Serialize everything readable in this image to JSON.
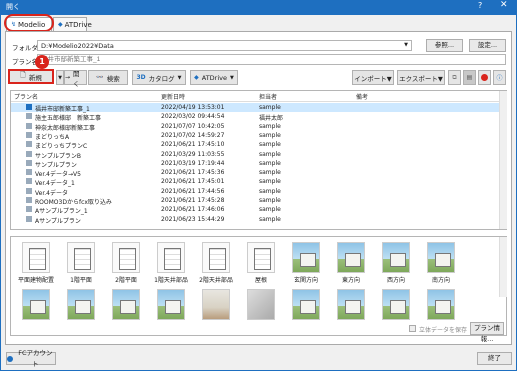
{
  "window": {
    "title": "開く",
    "help": "?",
    "close": "✕"
  },
  "tabs": [
    {
      "label": "Modelio"
    },
    {
      "label": "ATDrive"
    }
  ],
  "folder": {
    "label": "フォルダ",
    "value": "D:¥Modelio2022¥Data",
    "browse": "参照...",
    "settings": "設定..."
  },
  "plan_name": {
    "label": "プラン名",
    "placeholder": "福井市邸新築工事_1"
  },
  "toolbar": {
    "new_label": "新規",
    "callout": "1",
    "open_label": "開く",
    "search_label": "検索",
    "catalog_label": "カタログ",
    "atdrive_label": "ATDrive",
    "import_label": "インポート▼",
    "export_label": "エクスポート▼"
  },
  "list": {
    "columns": [
      "プラン名",
      "更新日時",
      "担当者",
      "備考"
    ],
    "rows": [
      {
        "name": "福井市邸新築工事_1",
        "date": "2022/04/19 13:53:01",
        "owner": "sample",
        "note": "",
        "selected": true
      },
      {
        "name": "施主五郎様邸　新築工事",
        "date": "2022/03/02 09:44:54",
        "owner": "福井太郎",
        "note": ""
      },
      {
        "name": "神奈太郎様邸新築工事",
        "date": "2021/07/07 10:42:05",
        "owner": "sample",
        "note": ""
      },
      {
        "name": "まどりっちA",
        "date": "2021/07/02 14:59:27",
        "owner": "sample",
        "note": ""
      },
      {
        "name": "まどりっちプランC",
        "date": "2021/06/21 17:45:10",
        "owner": "sample",
        "note": ""
      },
      {
        "name": "サンプルプランB",
        "date": "2021/03/29 11:03:55",
        "owner": "sample",
        "note": ""
      },
      {
        "name": "サンプルプラン",
        "date": "2021/03/19 17:19:44",
        "owner": "sample",
        "note": ""
      },
      {
        "name": "Ver.4データ→V5",
        "date": "2021/06/21 17:45:36",
        "owner": "sample",
        "note": ""
      },
      {
        "name": "Ver.4データ_1",
        "date": "2021/06/21 17:45:01",
        "owner": "sample",
        "note": ""
      },
      {
        "name": "Ver.4データ",
        "date": "2021/06/21 17:44:56",
        "owner": "sample",
        "note": ""
      },
      {
        "name": "ROOMO3Dからfcx取り込み",
        "date": "2021/06/21 17:45:28",
        "owner": "sample",
        "note": ""
      },
      {
        "name": "Aサンプルプラン_1",
        "date": "2021/06/21 17:46:06",
        "owner": "sample",
        "note": ""
      },
      {
        "name": "Aサンプルプラン",
        "date": "2021/06/23 15:44:29",
        "owner": "sample",
        "note": ""
      }
    ]
  },
  "thumbnails": {
    "row1": [
      "平面建物配置",
      "1階平面",
      "2階平面",
      "1階天井部品",
      "2階天井部品",
      "屋根",
      "玄関方向",
      "東方向",
      "西方向",
      "南方向"
    ],
    "save3d_label": "立体データを保存",
    "plan_info": "プラン情報..."
  },
  "footer": {
    "account": "FCアカウント",
    "close": "終了"
  },
  "colors": {
    "accent": "#1e6fc0",
    "callout": "#d9241c",
    "selected_row": "#cde8ff"
  }
}
